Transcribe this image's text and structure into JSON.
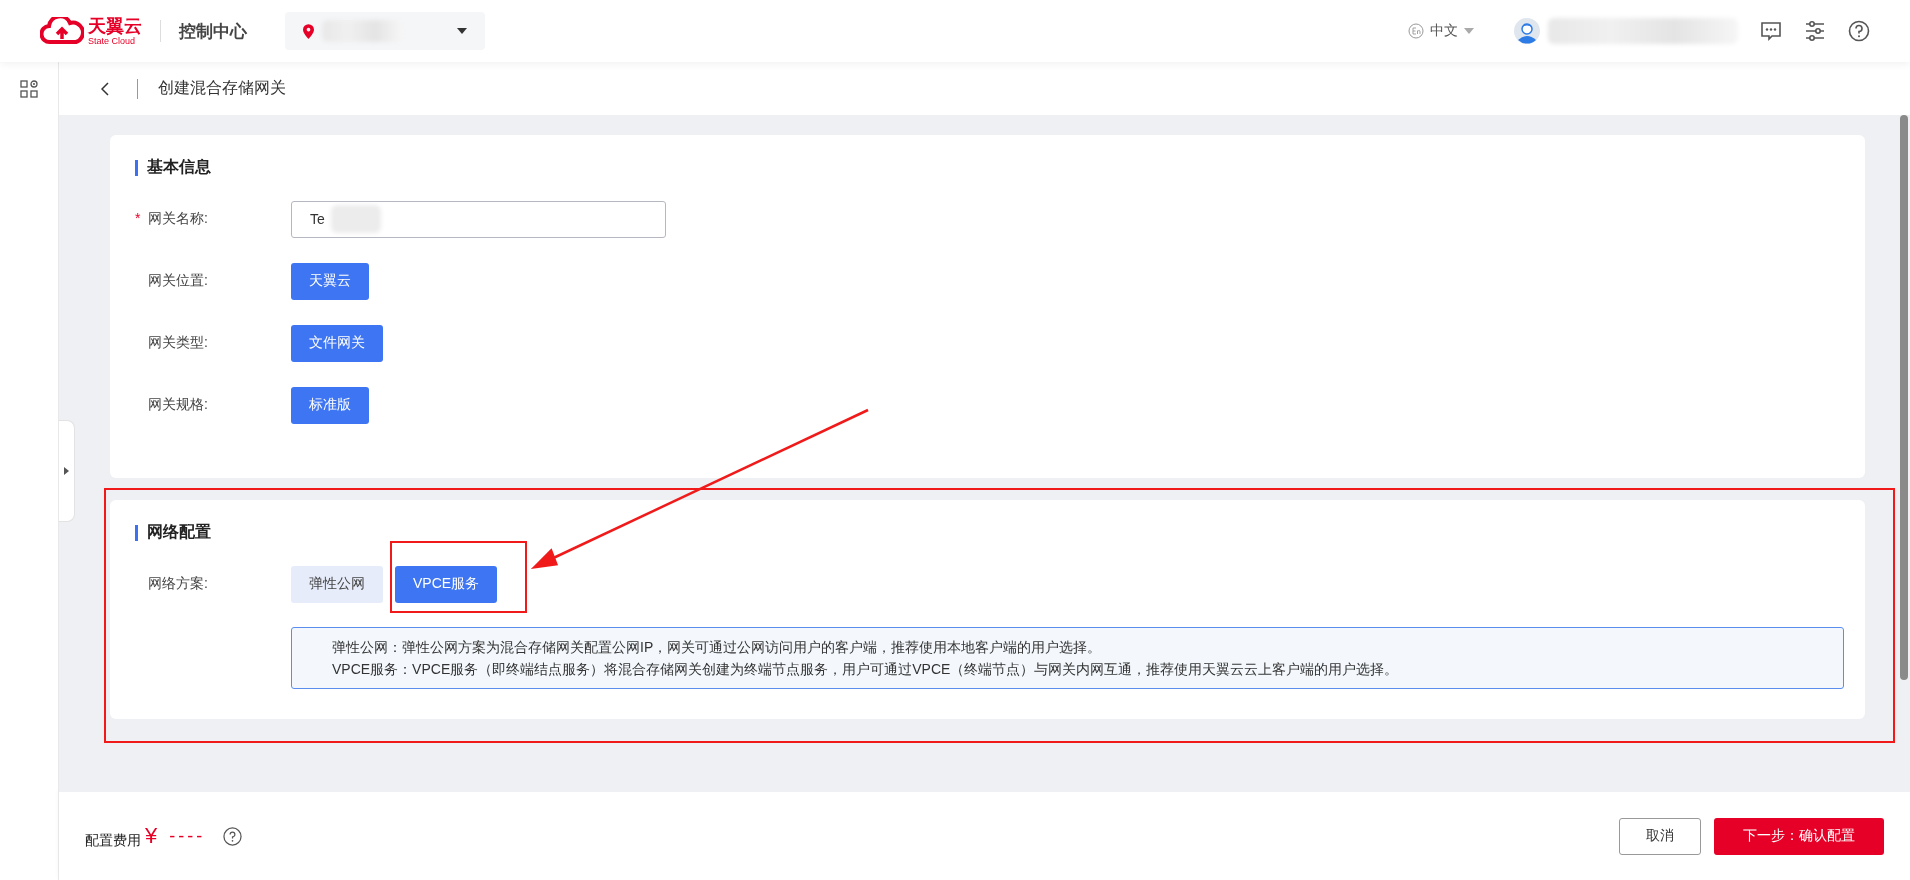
{
  "top_bar": {
    "logo_text": "天翼云",
    "logo_subtext": "State Cloud",
    "console_title": "控制中心",
    "language": "中文"
  },
  "page_title": "创建混合存储网关",
  "sections": [
    {
      "title": "基本信息",
      "fields": [
        {
          "kind": "input",
          "label": "网关名称:",
          "required_mark": "*",
          "value": "Te"
        },
        {
          "kind": "options",
          "label": "网关位置:",
          "options": [
            {
              "label": "天翼云",
              "selected": true
            }
          ]
        },
        {
          "kind": "options",
          "label": "网关类型:",
          "options": [
            {
              "label": "文件网关",
              "selected": true
            }
          ]
        },
        {
          "kind": "options",
          "label": "网关规格:",
          "options": [
            {
              "label": "标准版",
              "selected": true
            }
          ]
        }
      ]
    },
    {
      "title": "网络配置",
      "fields": [
        {
          "kind": "options",
          "label": "网络方案:",
          "options": [
            {
              "label": "弹性公网",
              "selected": false
            },
            {
              "label": "VPCE服务",
              "selected": true
            }
          ]
        }
      ],
      "notes": [
        "弹性公网：弹性公网方案为混合存储网关配置公网IP，网关可通过公网访问用户的客户端，推荐使用本地客户端的用户选择。",
        "VPCE服务：VPCE服务（即终端结点服务）将混合存储网关创建为终端节点服务，用户可通过VPCE（终端节点）与网关内网互通，推荐使用天翼云云上客户端的用户选择。"
      ]
    }
  ],
  "footer": {
    "fee_label": "配置费用",
    "currency": "¥",
    "fee_value": "----",
    "buttons": [
      {
        "kind": "secondary",
        "label": "取消"
      },
      {
        "kind": "primary",
        "label": "下一步：确认配置"
      }
    ]
  }
}
